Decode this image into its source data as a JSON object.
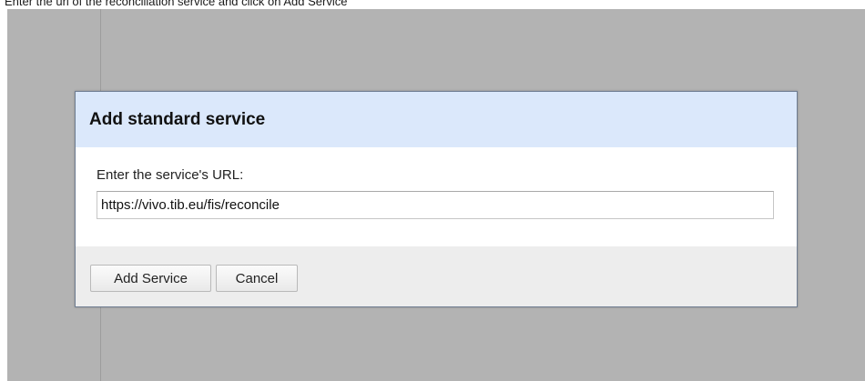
{
  "caption": "Enter the url of the reconciliation service and click on Add Service",
  "dialog": {
    "title": "Add standard service",
    "url_label": "Enter the service's URL:",
    "url_value": "https://vivo.tib.eu/fis/reconcile",
    "add_button_label": "Add Service",
    "cancel_button_label": "Cancel"
  },
  "colors": {
    "header_background": "#dbe8fb",
    "footer_background": "#ededed",
    "backdrop": "#b3b3b3"
  }
}
